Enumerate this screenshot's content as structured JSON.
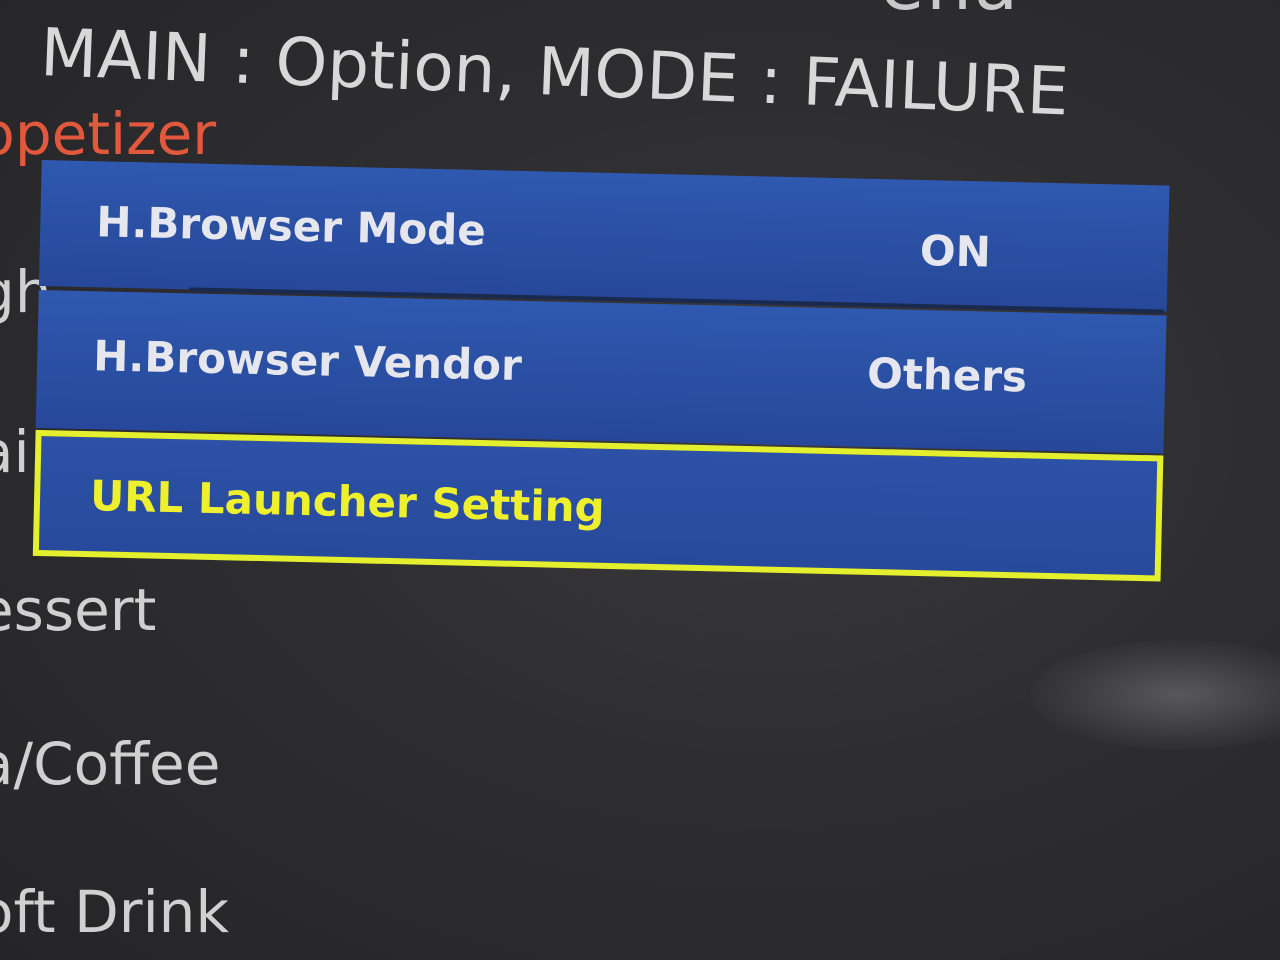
{
  "header": {
    "title": "MAIN : Option, MODE : FAILURE",
    "top_fragment": "ena"
  },
  "menu": {
    "items": [
      {
        "label": "ppetizer",
        "active": true
      },
      {
        "label": "gh"
      },
      {
        "label": "ai"
      },
      {
        "label": "essert"
      },
      {
        "label": "a/Coffee"
      },
      {
        "label": "oft Drink"
      }
    ]
  },
  "popup": {
    "rows": [
      {
        "label": "H.Browser Mode",
        "value": "ON"
      },
      {
        "label": "H.Browser Vendor",
        "value": "Others"
      },
      {
        "label": "URL Launcher Setting",
        "value": "",
        "focused": true
      }
    ]
  },
  "colors": {
    "popup_blue": "#2b50a6",
    "focus_yellow": "#e4ef2d",
    "active_menu": "#e2583c",
    "text_light": "#d8d8d8"
  }
}
